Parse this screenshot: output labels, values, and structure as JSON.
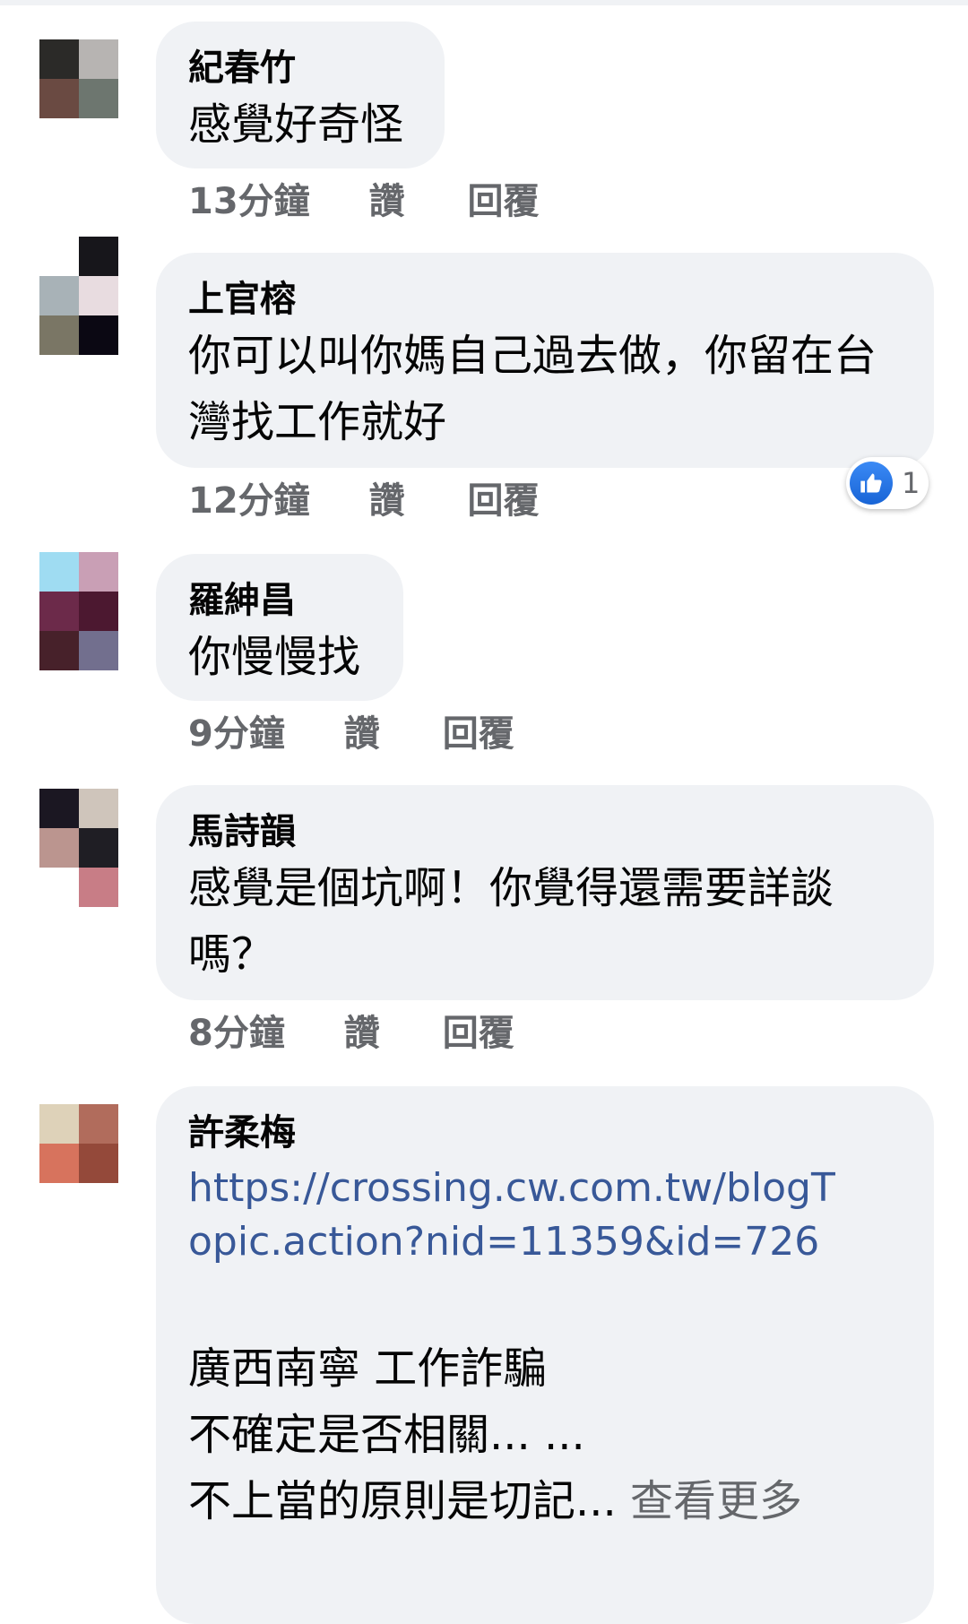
{
  "comments": [
    {
      "name": "紀春竹",
      "text_lines": [
        "感覺好奇怪"
      ],
      "time": "13分鐘",
      "like": "讚",
      "reply": "回覆",
      "avatar_colors": [
        "#2b2a28",
        "#b7b4b2",
        "#6a4a42",
        "#6d766f"
      ]
    },
    {
      "name": "上官榕",
      "text_lines": [
        "你可以叫你媽自己過去做，你留在台",
        "灣找工作就好"
      ],
      "time": "12分鐘",
      "like": "讚",
      "reply": "回覆",
      "reaction": {
        "icon": "thumbs-up-icon",
        "count": "1"
      },
      "avatar_colors": [
        "#ffffff",
        "#17161b",
        "#a8b2b7",
        "#e8dce0",
        "#7a7665",
        "#0b0813"
      ]
    },
    {
      "name": "羅紳昌",
      "text_lines": [
        "你慢慢找"
      ],
      "time": "9分鐘",
      "like": "讚",
      "reply": "回覆",
      "avatar_colors": [
        "#9fdcf2",
        "#c99fb5",
        "#6c2a4a",
        "#4c1830",
        "#47212a",
        "#726f8e"
      ]
    },
    {
      "name": "馬詩韻",
      "text_lines": [
        "感覺是個坑啊！你覺得還需要詳談",
        "嗎？"
      ],
      "time": "8分鐘",
      "like": "讚",
      "reply": "回覆",
      "avatar_colors": [
        "#1b1722",
        "#cfc5bb",
        "#bb958f",
        "#1f1e24",
        "#ffffff",
        "#c87d86"
      ]
    },
    {
      "name": "許柔梅",
      "link": "https://crossing.cw.com.tw/blogTopic.action?nid=11359&id=726",
      "text_lines": [
        "廣西南寧 工作詐騙",
        "不確定是否相關... ..."
      ],
      "last_line": "不上當的原則是切記...",
      "see_more": "查看更多",
      "avatar_colors": [
        "#ded2b9",
        "#b16c5c",
        "#d7735d",
        "#94493a"
      ]
    }
  ]
}
